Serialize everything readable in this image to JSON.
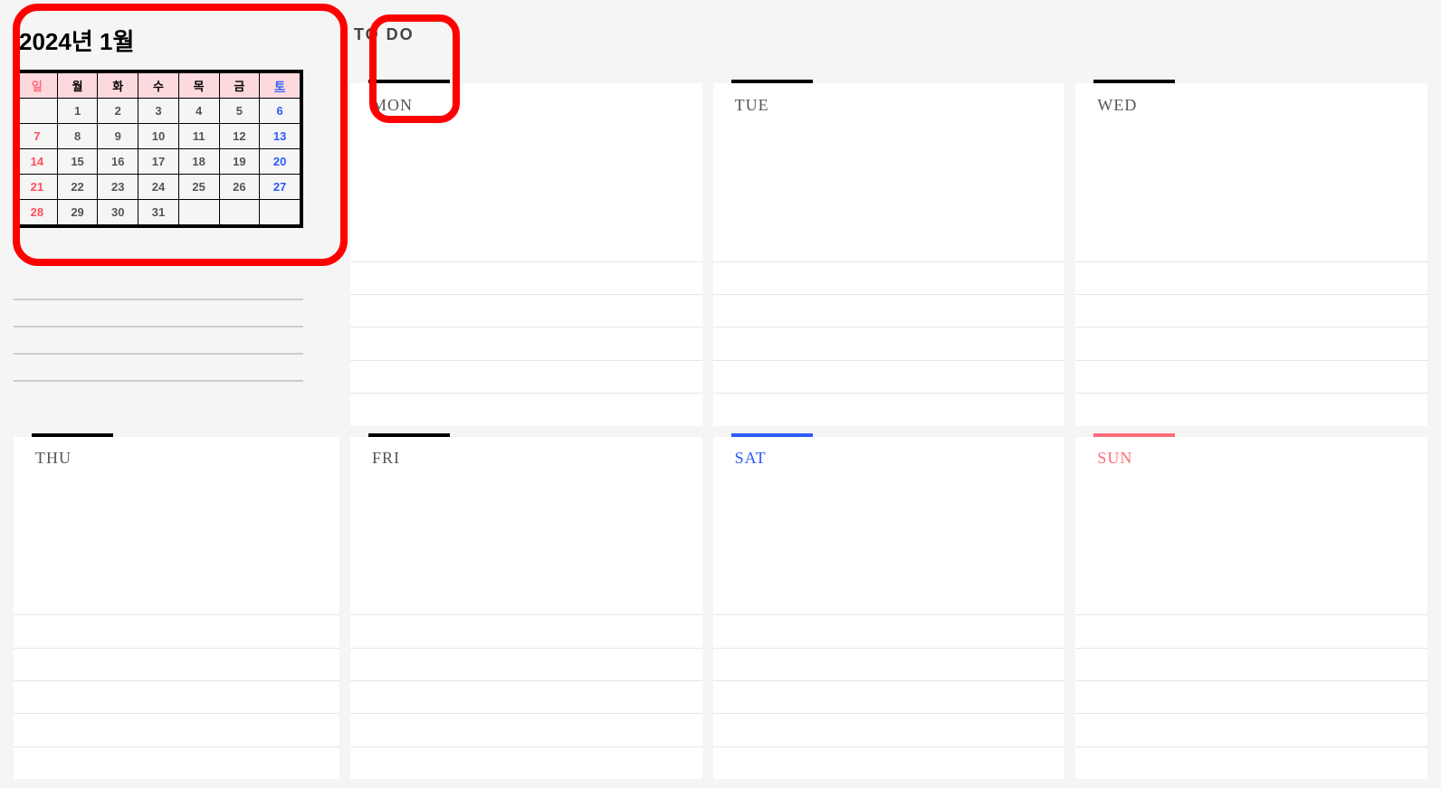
{
  "calendar": {
    "title": "2024년 1월",
    "weekdays": [
      "일",
      "월",
      "화",
      "수",
      "목",
      "금",
      "토"
    ],
    "rows": [
      [
        "",
        "1",
        "2",
        "3",
        "4",
        "5",
        "6"
      ],
      [
        "7",
        "8",
        "9",
        "10",
        "11",
        "12",
        "13"
      ],
      [
        "14",
        "15",
        "16",
        "17",
        "18",
        "19",
        "20"
      ],
      [
        "21",
        "22",
        "23",
        "24",
        "25",
        "26",
        "27"
      ],
      [
        "28",
        "29",
        "30",
        "31",
        "",
        "",
        ""
      ]
    ]
  },
  "todo": {
    "label": "TO DO"
  },
  "days": {
    "mon": "MON",
    "tue": "TUE",
    "wed": "WED",
    "thu": "THU",
    "fri": "FRI",
    "sat": "SAT",
    "sun": "SUN"
  }
}
